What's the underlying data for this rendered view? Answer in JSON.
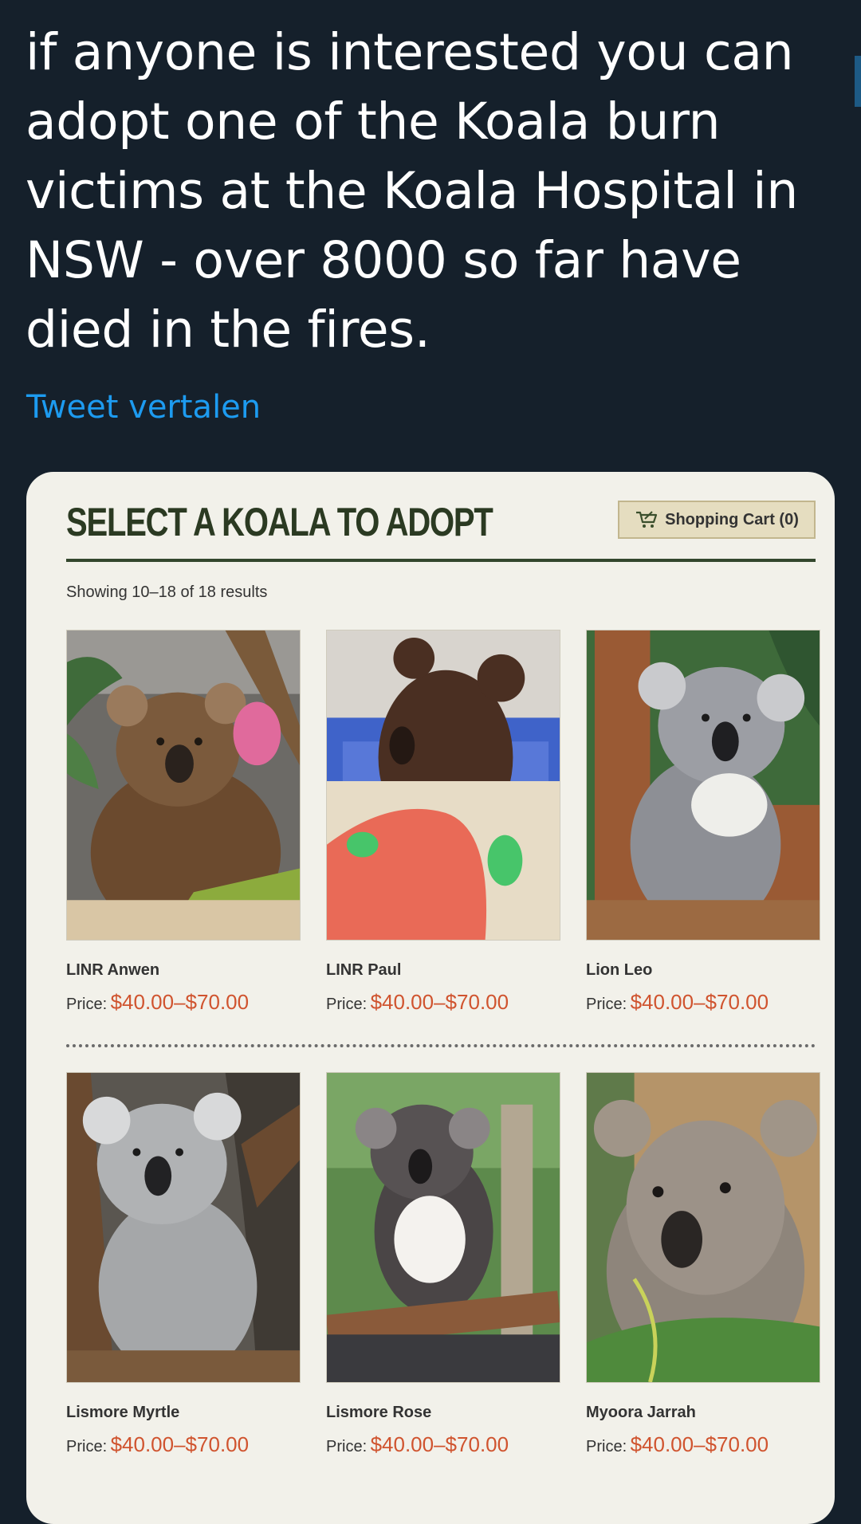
{
  "tweet": {
    "text": "if anyone is interested you can adopt one of the Koala burn victims at the Koala Hospital in NSW - over 8000 so far have died in the fires.",
    "translate_link": "Tweet vertalen"
  },
  "shop": {
    "title": "SELECT A KOALA TO ADOPT",
    "cart_label": "Shopping Cart (0)",
    "results_text": "Showing 10–18 of 18 results",
    "price_label": "Price:",
    "accent_color": "#d0542f",
    "title_color": "#2b3a22",
    "products": [
      {
        "name": "LINR Anwen",
        "price": "$40.00–$70.00",
        "photo": "koala-burn-patient-photo"
      },
      {
        "name": "LINR Paul",
        "price": "$40.00–$70.00",
        "photo": "koala-in-basket-photo"
      },
      {
        "name": "Lion Leo",
        "price": "$40.00–$70.00",
        "photo": "koala-in-tree-photo"
      },
      {
        "name": "Lismore Myrtle",
        "price": "$40.00–$70.00",
        "photo": "koala-on-branch-photo"
      },
      {
        "name": "Lismore Rose",
        "price": "$40.00–$70.00",
        "photo": "koala-on-perch-photo"
      },
      {
        "name": "Myoora Jarrah",
        "price": "$40.00–$70.00",
        "photo": "koala-with-leaves-photo"
      }
    ]
  }
}
